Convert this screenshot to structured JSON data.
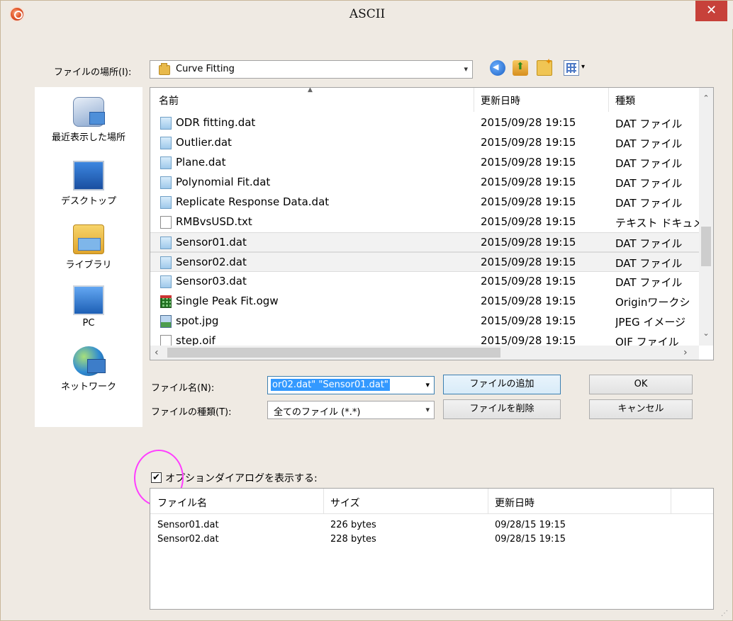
{
  "window": {
    "title": "ASCII",
    "close_glyph": "✕"
  },
  "location": {
    "label": "ファイルの場所(I):",
    "value": "Curve Fitting"
  },
  "toolbar": {
    "icons": [
      "back-icon",
      "up-folder-icon",
      "new-folder-icon",
      "view-menu-icon"
    ],
    "view_arrow": "▾"
  },
  "places": [
    {
      "label": "最近表示した場所",
      "icon": "recent-places-icon"
    },
    {
      "label": "デスクトップ",
      "icon": "desktop-icon"
    },
    {
      "label": "ライブラリ",
      "icon": "library-icon"
    },
    {
      "label": "PC",
      "icon": "pc-icon"
    },
    {
      "label": "ネットワーク",
      "icon": "network-icon"
    }
  ],
  "file_list": {
    "columns": [
      "名前",
      "更新日時",
      "種類"
    ],
    "rows": [
      {
        "name": "ODR fitting.dat",
        "date": "2015/09/28 19:15",
        "type": "DAT ファイル",
        "icon": "dat"
      },
      {
        "name": "Outlier.dat",
        "date": "2015/09/28 19:15",
        "type": "DAT ファイル",
        "icon": "dat"
      },
      {
        "name": "Plane.dat",
        "date": "2015/09/28 19:15",
        "type": "DAT ファイル",
        "icon": "dat"
      },
      {
        "name": "Polynomial Fit.dat",
        "date": "2015/09/28 19:15",
        "type": "DAT ファイル",
        "icon": "dat"
      },
      {
        "name": "Replicate Response Data.dat",
        "date": "2015/09/28 19:15",
        "type": "DAT ファイル",
        "icon": "dat"
      },
      {
        "name": "RMBvsUSD.txt",
        "date": "2015/09/28 19:15",
        "type": "テキスト ドキュメ",
        "icon": "txt"
      },
      {
        "name": "Sensor01.dat",
        "date": "2015/09/28 19:15",
        "type": "DAT ファイル",
        "icon": "dat",
        "selected": true
      },
      {
        "name": "Sensor02.dat",
        "date": "2015/09/28 19:15",
        "type": "DAT ファイル",
        "icon": "dat",
        "selected": true
      },
      {
        "name": "Sensor03.dat",
        "date": "2015/09/28 19:15",
        "type": "DAT ファイル",
        "icon": "dat"
      },
      {
        "name": "Single Peak Fit.ogw",
        "date": "2015/09/28 19:15",
        "type": "Originワークシ",
        "icon": "ogw"
      },
      {
        "name": "spot.jpg",
        "date": "2015/09/28 19:15",
        "type": "JPEG イメージ",
        "icon": "jpg"
      },
      {
        "name": "step.oif",
        "date": "2015/09/28 19:15",
        "type": "OIF ファイル",
        "icon": "txt"
      }
    ]
  },
  "filename": {
    "label": "ファイル名(N):",
    "value": "or02.dat\" \"Sensor01.dat\""
  },
  "filetype": {
    "label": "ファイルの種類(T):",
    "value": "全てのファイル (*.*)"
  },
  "buttons": {
    "add": "ファイルの追加",
    "remove": "ファイルを削除",
    "ok": "OK",
    "cancel": "キャンセル"
  },
  "options_checkbox": {
    "label": "オプションダイアログを表示する:",
    "checked": true,
    "mark": "✔"
  },
  "selected_files": {
    "columns": [
      "ファイル名",
      "サイズ",
      "更新日時"
    ],
    "rows": [
      {
        "name": "Sensor01.dat",
        "size": "226 bytes",
        "date": "09/28/15 19:15"
      },
      {
        "name": "Sensor02.dat",
        "size": "228 bytes",
        "date": "09/28/15 19:15"
      }
    ]
  },
  "colors": {
    "accent": "#3399ff",
    "close": "#c7413a",
    "highlight_circle": "#ff3dff"
  }
}
